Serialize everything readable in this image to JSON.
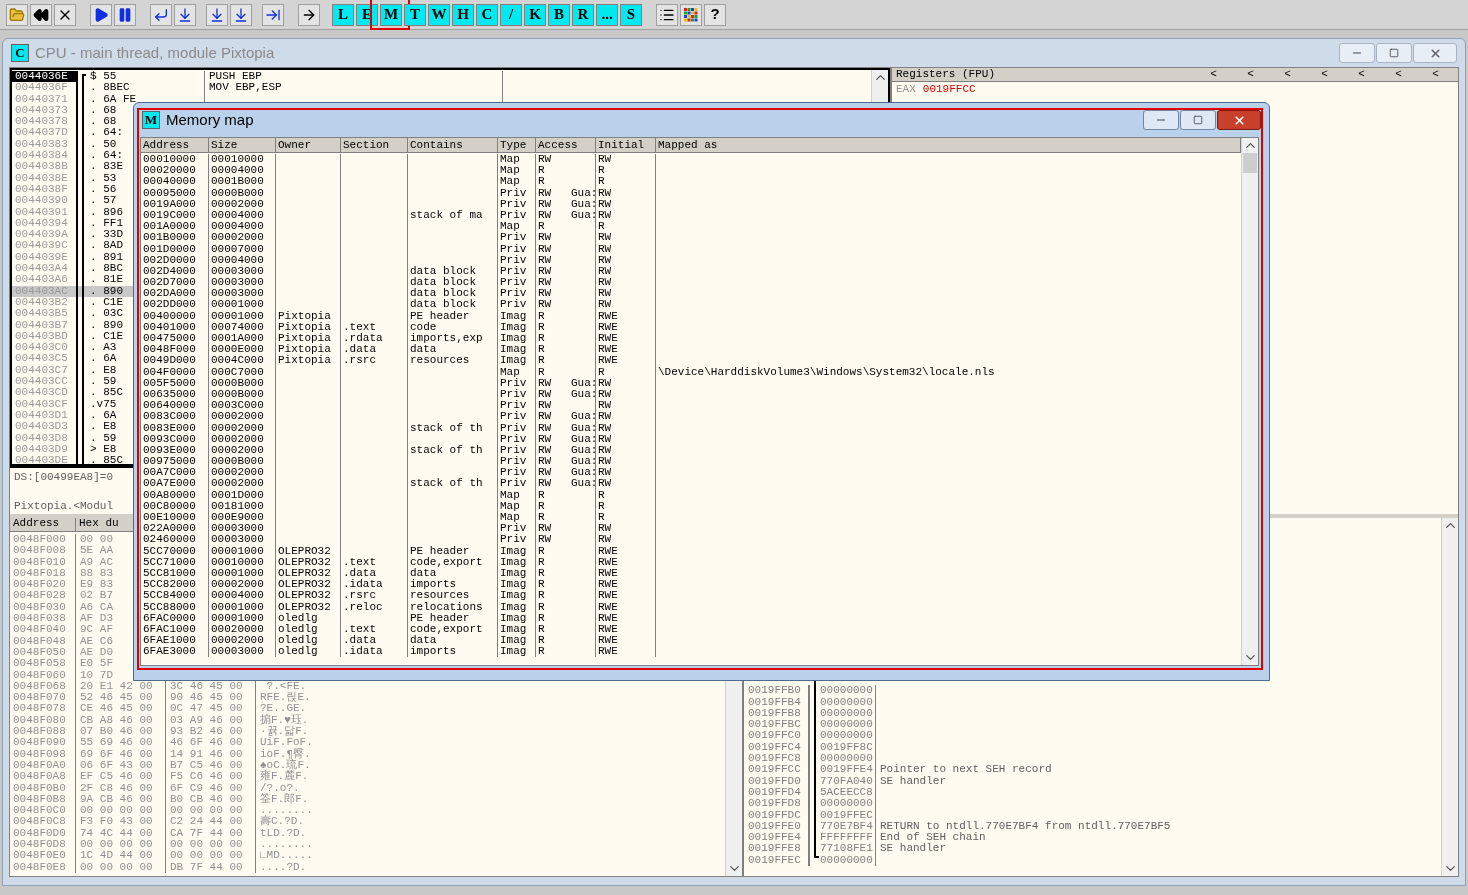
{
  "toolbar": {
    "letter_buttons": [
      {
        "label": "L",
        "highlighted": false
      },
      {
        "label": "E",
        "highlighted": false
      },
      {
        "label": "M",
        "highlighted": true
      },
      {
        "label": "T",
        "highlighted": false
      },
      {
        "label": "W",
        "highlighted": false
      },
      {
        "label": "H",
        "highlighted": false
      },
      {
        "label": "C",
        "highlighted": false
      },
      {
        "label": "/",
        "highlighted": false
      },
      {
        "label": "K",
        "highlighted": false
      },
      {
        "label": "B",
        "highlighted": false
      },
      {
        "label": "R",
        "highlighted": false
      },
      {
        "label": "...",
        "highlighted": false
      },
      {
        "label": "S",
        "highlighted": false
      }
    ],
    "help_button": "?"
  },
  "cpu_window": {
    "icon_letter": "C",
    "title": "CPU - main thread, module Pixtopia",
    "active": false,
    "disassembly": [
      {
        "address": "0044036E",
        "bytes": "$ 55",
        "instruction": "PUSH EBP",
        "cursor": true,
        "selected": false
      },
      {
        "address": "0044036F",
        "bytes": ". 8BEC",
        "instruction": "MOV EBP,ESP",
        "cursor": false,
        "selected": false
      },
      {
        "address": "00440371",
        "bytes": ". 6A FE",
        "cursor": false,
        "selected": false
      },
      {
        "address": "00440373",
        "bytes": ". 68",
        "cursor": false,
        "selected": false
      },
      {
        "address": "00440378",
        "bytes": ". 68",
        "cursor": false,
        "selected": false
      },
      {
        "address": "0044037D",
        "bytes": ". 64:",
        "cursor": false,
        "selected": false
      },
      {
        "address": "00440383",
        "bytes": ". 50",
        "cursor": false,
        "selected": false
      },
      {
        "address": "00440384",
        "bytes": ". 64:",
        "cursor": false,
        "selected": false
      },
      {
        "address": "0044038B",
        "bytes": ". 83E",
        "cursor": false,
        "selected": false
      },
      {
        "address": "0044038E",
        "bytes": ". 53",
        "cursor": false,
        "selected": false
      },
      {
        "address": "0044038F",
        "bytes": ". 56",
        "cursor": false,
        "selected": false
      },
      {
        "address": "00440390",
        "bytes": ". 57",
        "cursor": false,
        "selected": false
      },
      {
        "address": "00440391",
        "bytes": ". 896",
        "cursor": false,
        "selected": false
      },
      {
        "address": "00440394",
        "bytes": ". FF1",
        "cursor": false,
        "selected": false
      },
      {
        "address": "0044039A",
        "bytes": ". 33D",
        "cursor": false,
        "selected": false
      },
      {
        "address": "0044039C",
        "bytes": ". 8AD",
        "cursor": false,
        "selected": false
      },
      {
        "address": "0044039E",
        "bytes": ". 891",
        "cursor": false,
        "selected": false
      },
      {
        "address": "004403A4",
        "bytes": ". 8BC",
        "cursor": false,
        "selected": false
      },
      {
        "address": "004403A6",
        "bytes": ". 81E",
        "cursor": false,
        "selected": false
      },
      {
        "address": "004403AC",
        "bytes": ". 890",
        "cursor": false,
        "selected": true
      },
      {
        "address": "004403B2",
        "bytes": ". C1E",
        "cursor": false,
        "selected": false
      },
      {
        "address": "004403B5",
        "bytes": ". 03C",
        "cursor": false,
        "selected": false
      },
      {
        "address": "004403B7",
        "bytes": ". 890",
        "cursor": false,
        "selected": false
      },
      {
        "address": "004403BD",
        "bytes": ". C1E",
        "cursor": false,
        "selected": false
      },
      {
        "address": "004403C0",
        "bytes": ". A3",
        "cursor": false,
        "selected": false
      },
      {
        "address": "004403C5",
        "bytes": ". 6A",
        "cursor": false,
        "selected": false
      },
      {
        "address": "004403C7",
        "bytes": ". E8",
        "cursor": false,
        "selected": false
      },
      {
        "address": "004403CC",
        "bytes": ". 59",
        "cursor": false,
        "selected": false
      },
      {
        "address": "004403CD",
        "bytes": ". 85C",
        "cursor": false,
        "selected": false
      },
      {
        "address": "004403CF",
        "bytes": ".v75",
        "cursor": false,
        "selected": false
      },
      {
        "address": "004403D1",
        "bytes": ". 6A",
        "cursor": false,
        "selected": false
      },
      {
        "address": "004403D3",
        "bytes": ". E8",
        "cursor": false,
        "selected": false
      },
      {
        "address": "004403D8",
        "bytes": ". 59",
        "cursor": false,
        "selected": false
      },
      {
        "address": "004403D9",
        "bytes": "> E8",
        "cursor": false,
        "selected": false
      },
      {
        "address": "004403DE",
        "bytes": ". 85C",
        "cursor": false,
        "selected": false
      }
    ],
    "info_lines": [
      "DS:[00499EA8]=0",
      "Pixtopia.<Modul"
    ],
    "registers": {
      "title": "Registers (FPU)",
      "arrows": [
        "<",
        "<",
        "<",
        "<",
        "<",
        "<",
        "<"
      ],
      "first_register": {
        "name": "EAX",
        "value": "0019FFCC"
      }
    },
    "dump": {
      "columns": [
        "Address",
        "Hex du"
      ],
      "rows": [
        {
          "address": "0048F000",
          "hex": [
            "00",
            "00"
          ]
        },
        {
          "address": "0048F008",
          "hex": [
            "5E",
            "AA"
          ]
        },
        {
          "address": "0048F010",
          "hex": [
            "A9",
            "AC"
          ]
        },
        {
          "address": "0048F018",
          "hex": [
            "88",
            "83"
          ]
        },
        {
          "address": "0048F020",
          "hex": [
            "E9",
            "83"
          ]
        },
        {
          "address": "0048F028",
          "hex": [
            "02",
            "B7"
          ]
        },
        {
          "address": "0048F030",
          "hex": [
            "A6",
            "CA"
          ]
        },
        {
          "address": "0048F038",
          "hex": [
            "AF",
            "D3"
          ]
        },
        {
          "address": "0048F040",
          "hex": [
            "9C",
            "AF"
          ]
        },
        {
          "address": "0048F048",
          "hex": [
            "AE",
            "C6"
          ]
        },
        {
          "address": "0048F050",
          "hex": [
            "AE",
            "D0"
          ]
        },
        {
          "address": "0048F058",
          "hex": [
            "E0",
            "5F"
          ]
        },
        {
          "address": "0048F060",
          "hex": [
            "10",
            "7D"
          ]
        },
        {
          "address": "0048F068",
          "hex": [
            "20",
            "E1",
            "42",
            "00",
            "3C",
            "46",
            "45",
            "00"
          ],
          "ascii": " ?.<FE."
        },
        {
          "address": "0048F070",
          "hex": [
            "52",
            "46",
            "45",
            "00",
            "90",
            "46",
            "45",
            "00"
          ],
          "ascii": "RFE.릱E."
        },
        {
          "address": "0048F078",
          "hex": [
            "CE",
            "46",
            "45",
            "00",
            "0C",
            "47",
            "45",
            "00"
          ],
          "ascii": "?E..GE."
        },
        {
          "address": "0048F080",
          "hex": [
            "CB",
            "A8",
            "46",
            "00",
            "03",
            "A9",
            "46",
            "00"
          ],
          "ascii": "掮F.♥珏."
        },
        {
          "address": "0048F088",
          "hex": [
            "07",
            "B0",
            "46",
            "00",
            "93",
            "B2",
            "46",
            "00"
          ],
          "ascii": "·뀱.닯F."
        },
        {
          "address": "0048F090",
          "hex": [
            "55",
            "69",
            "46",
            "00",
            "46",
            "6F",
            "46",
            "00"
          ],
          "ascii": "UiF.FoF."
        },
        {
          "address": "0048F098",
          "hex": [
            "69",
            "6F",
            "46",
            "00",
            "14",
            "91",
            "46",
            "00"
          ],
          "ascii": "ioF.¶臀."
        },
        {
          "address": "0048F0A0",
          "hex": [
            "06",
            "6F",
            "43",
            "00",
            "B7",
            "C5",
            "46",
            "00"
          ],
          "ascii": "♠oC.琉F."
        },
        {
          "address": "0048F0A8",
          "hex": [
            "EF",
            "C5",
            "46",
            "00",
            "F5",
            "C6",
            "46",
            "00"
          ],
          "ascii": "雍F.麓F."
        },
        {
          "address": "0048F0B0",
          "hex": [
            "2F",
            "C8",
            "46",
            "00",
            "6F",
            "C9",
            "46",
            "00"
          ],
          "ascii": "/?.o?."
        },
        {
          "address": "0048F0B8",
          "hex": [
            "9A",
            "CB",
            "46",
            "00",
            "B0",
            "CB",
            "46",
            "00"
          ],
          "ascii": "筌F.郎F."
        },
        {
          "address": "0048F0C0",
          "hex": [
            "00",
            "00",
            "00",
            "00",
            "00",
            "00",
            "00",
            "00"
          ],
          "ascii": "........"
        },
        {
          "address": "0048F0C8",
          "hex": [
            "F3",
            "F0",
            "43",
            "00",
            "C2",
            "24",
            "44",
            "00"
          ],
          "ascii": "壽C.?D."
        },
        {
          "address": "0048F0D0",
          "hex": [
            "74",
            "4C",
            "44",
            "00",
            "CA",
            "7F",
            "44",
            "00"
          ],
          "ascii": "tLD.?D."
        },
        {
          "address": "0048F0D8",
          "hex": [
            "00",
            "00",
            "00",
            "00",
            "00",
            "00",
            "00",
            "00"
          ],
          "ascii": "........"
        },
        {
          "address": "0048F0E0",
          "hex": [
            "1C",
            "4D",
            "44",
            "00",
            "00",
            "00",
            "00",
            "00"
          ],
          "ascii": "∟MD....."
        },
        {
          "address": "0048F0E8",
          "hex": [
            "00",
            "00",
            "00",
            "00",
            "DB",
            "7F",
            "44",
            "00"
          ],
          "ascii": "....?D."
        }
      ]
    },
    "stack": [
      {
        "address": "0019FFB0",
        "value": "00000000"
      },
      {
        "address": "0019FFB4",
        "value": "00000000"
      },
      {
        "address": "0019FFB8",
        "value": "00000000"
      },
      {
        "address": "0019FFBC",
        "value": "00000000"
      },
      {
        "address": "0019FFC0",
        "value": "00000000"
      },
      {
        "address": "0019FFC4",
        "value": "0019FF8C"
      },
      {
        "address": "0019FFC8",
        "value": "00000000"
      },
      {
        "address": "0019FFCC",
        "value": "0019FFE4",
        "comment": "Pointer to next SEH record"
      },
      {
        "address": "0019FFD0",
        "value": "770FA040",
        "comment": "SE handler"
      },
      {
        "address": "0019FFD4",
        "value": "5ACEECC8"
      },
      {
        "address": "0019FFD8",
        "value": "00000000"
      },
      {
        "address": "0019FFDC",
        "value": "0019FFEC"
      },
      {
        "address": "0019FFE0",
        "value": "770E7BF4",
        "comment": "RETURN to ntdll.770E7BF4 from ntdll.770E7BF5"
      },
      {
        "address": "0019FFE4",
        "value": "FFFFFFFF",
        "comment": "End of SEH chain"
      },
      {
        "address": "0019FFE8",
        "value": "77108FE1",
        "comment": "SE handler"
      },
      {
        "address": "0019FFEC",
        "value": "00000000"
      }
    ]
  },
  "memory_map_window": {
    "icon_letter": "M",
    "title": "Memory map",
    "active": true,
    "highlighted": true,
    "columns": [
      "Address",
      "Size",
      "Owner",
      "Section",
      "Contains",
      "Type",
      "Access",
      "Initial",
      "Mapped as"
    ],
    "rows": [
      {
        "address": "00010000",
        "size": "00010000",
        "type": "Map",
        "access": "RW",
        "initial": "RW"
      },
      {
        "address": "00020000",
        "size": "00004000",
        "type": "Map",
        "access": "R",
        "initial": "R"
      },
      {
        "address": "00040000",
        "size": "0001B000",
        "type": "Map",
        "access": "R",
        "initial": "R"
      },
      {
        "address": "00095000",
        "size": "0000B000",
        "type": "Priv",
        "access": "RW",
        "guard": "Gua:",
        "initial": "RW"
      },
      {
        "address": "0019A000",
        "size": "00002000",
        "type": "Priv",
        "access": "RW",
        "guard": "Gua:",
        "initial": "RW"
      },
      {
        "address": "0019C000",
        "size": "00004000",
        "contains": "stack of ma",
        "type": "Priv",
        "access": "RW",
        "guard": "Gua:",
        "initial": "RW"
      },
      {
        "address": "001A0000",
        "size": "00004000",
        "type": "Map",
        "access": "R",
        "initial": "R"
      },
      {
        "address": "001B0000",
        "size": "00002000",
        "type": "Priv",
        "access": "RW",
        "initial": "RW"
      },
      {
        "address": "001D0000",
        "size": "00007000",
        "type": "Priv",
        "access": "RW",
        "initial": "RW"
      },
      {
        "address": "002D0000",
        "size": "00004000",
        "type": "Priv",
        "access": "RW",
        "initial": "RW"
      },
      {
        "address": "002D4000",
        "size": "00003000",
        "contains": "data block",
        "type": "Priv",
        "access": "RW",
        "initial": "RW"
      },
      {
        "address": "002D7000",
        "size": "00003000",
        "contains": "data block",
        "type": "Priv",
        "access": "RW",
        "initial": "RW"
      },
      {
        "address": "002DA000",
        "size": "00003000",
        "contains": "data block",
        "type": "Priv",
        "access": "RW",
        "initial": "RW"
      },
      {
        "address": "002DD000",
        "size": "00001000",
        "contains": "data block",
        "type": "Priv",
        "access": "RW",
        "initial": "RW"
      },
      {
        "address": "00400000",
        "size": "00001000",
        "owner": "Pixtopia",
        "contains": "PE header",
        "type": "Imag",
        "access": "R",
        "initial": "RWE"
      },
      {
        "address": "00401000",
        "size": "00074000",
        "owner": "Pixtopia",
        "section": ".text",
        "contains": "code",
        "type": "Imag",
        "access": "R",
        "initial": "RWE"
      },
      {
        "address": "00475000",
        "size": "0001A000",
        "owner": "Pixtopia",
        "section": ".rdata",
        "contains": "imports,exp",
        "type": "Imag",
        "access": "R",
        "initial": "RWE"
      },
      {
        "address": "0048F000",
        "size": "0000E000",
        "owner": "Pixtopia",
        "section": ".data",
        "contains": "data",
        "type": "Imag",
        "access": "R",
        "initial": "RWE"
      },
      {
        "address": "0049D000",
        "size": "0004C000",
        "owner": "Pixtopia",
        "section": ".rsrc",
        "contains": "resources",
        "type": "Imag",
        "access": "R",
        "initial": "RWE"
      },
      {
        "address": "004F0000",
        "size": "000C7000",
        "type": "Map",
        "access": "R",
        "initial": "R",
        "mapped_as": "\\Device\\HarddiskVolume3\\Windows\\System32\\locale.nls"
      },
      {
        "address": "005F5000",
        "size": "0000B000",
        "type": "Priv",
        "access": "RW",
        "guard": "Gua:",
        "initial": "RW"
      },
      {
        "address": "00635000",
        "size": "0000B000",
        "type": "Priv",
        "access": "RW",
        "guard": "Gua:",
        "initial": "RW"
      },
      {
        "address": "00640000",
        "size": "0003C000",
        "type": "Priv",
        "access": "RW",
        "initial": "RW"
      },
      {
        "address": "0083C000",
        "size": "00002000",
        "type": "Priv",
        "access": "RW",
        "guard": "Gua:",
        "initial": "RW"
      },
      {
        "address": "0083E000",
        "size": "00002000",
        "contains": "stack of th",
        "type": "Priv",
        "access": "RW",
        "guard": "Gua:",
        "initial": "RW"
      },
      {
        "address": "0093C000",
        "size": "00002000",
        "type": "Priv",
        "access": "RW",
        "guard": "Gua:",
        "initial": "RW"
      },
      {
        "address": "0093E000",
        "size": "00002000",
        "contains": "stack of th",
        "type": "Priv",
        "access": "RW",
        "guard": "Gua:",
        "initial": "RW"
      },
      {
        "address": "00975000",
        "size": "0000B000",
        "type": "Priv",
        "access": "RW",
        "guard": "Gua:",
        "initial": "RW"
      },
      {
        "address": "00A7C000",
        "size": "00002000",
        "type": "Priv",
        "access": "RW",
        "guard": "Gua:",
        "initial": "RW"
      },
      {
        "address": "00A7E000",
        "size": "00002000",
        "contains": "stack of th",
        "type": "Priv",
        "access": "RW",
        "guard": "Gua:",
        "initial": "RW"
      },
      {
        "address": "00A80000",
        "size": "0001D000",
        "type": "Map",
        "access": "R",
        "initial": "R"
      },
      {
        "address": "00C80000",
        "size": "00181000",
        "type": "Map",
        "access": "R",
        "initial": "R"
      },
      {
        "address": "00E10000",
        "size": "000E9000",
        "type": "Map",
        "access": "R",
        "initial": "R"
      },
      {
        "address": "022A0000",
        "size": "00003000",
        "type": "Priv",
        "access": "RW",
        "initial": "RW"
      },
      {
        "address": "02460000",
        "size": "00003000",
        "type": "Priv",
        "access": "RW",
        "initial": "RW"
      },
      {
        "address": "5CC70000",
        "size": "00001000",
        "owner": "OLEPRO32",
        "contains": "PE header",
        "type": "Imag",
        "access": "R",
        "initial": "RWE"
      },
      {
        "address": "5CC71000",
        "size": "00010000",
        "owner": "OLEPRO32",
        "section": ".text",
        "contains": "code,export",
        "type": "Imag",
        "access": "R",
        "initial": "RWE"
      },
      {
        "address": "5CC81000",
        "size": "00001000",
        "owner": "OLEPRO32",
        "section": ".data",
        "contains": "data",
        "type": "Imag",
        "access": "R",
        "initial": "RWE"
      },
      {
        "address": "5CC82000",
        "size": "00002000",
        "owner": "OLEPRO32",
        "section": ".idata",
        "contains": "imports",
        "type": "Imag",
        "access": "R",
        "initial": "RWE"
      },
      {
        "address": "5CC84000",
        "size": "00004000",
        "owner": "OLEPRO32",
        "section": ".rsrc",
        "contains": "resources",
        "type": "Imag",
        "access": "R",
        "initial": "RWE"
      },
      {
        "address": "5CC88000",
        "size": "00001000",
        "owner": "OLEPRO32",
        "section": ".reloc",
        "contains": "relocations",
        "type": "Imag",
        "access": "R",
        "initial": "RWE"
      },
      {
        "address": "6FAC0000",
        "size": "00001000",
        "owner": "oledlg",
        "contains": "PE header",
        "type": "Imag",
        "access": "R",
        "initial": "RWE"
      },
      {
        "address": "6FAC1000",
        "size": "00020000",
        "owner": "oledlg",
        "section": ".text",
        "contains": "code,export",
        "type": "Imag",
        "access": "R",
        "initial": "RWE"
      },
      {
        "address": "6FAE1000",
        "size": "00002000",
        "owner": "oledlg",
        "section": ".data",
        "contains": "data",
        "type": "Imag",
        "access": "R",
        "initial": "RWE"
      },
      {
        "address": "6FAE3000",
        "size": "00003000",
        "owner": "oledlg",
        "section": ".idata",
        "contains": "imports",
        "type": "Imag",
        "access": "R",
        "initial": "RWE"
      }
    ]
  }
}
